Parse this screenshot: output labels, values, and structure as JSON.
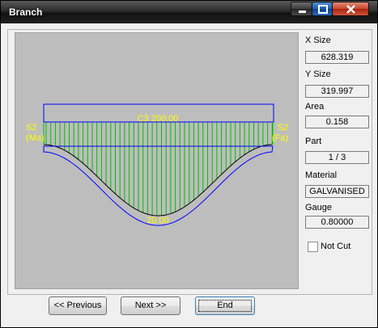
{
  "window": {
    "title": "Branch",
    "buttons": {
      "minimize": "minimize",
      "maximize": "maximize",
      "close": "close"
    }
  },
  "drawing": {
    "top_label": "C3 200.00",
    "bottom_label": "20.00",
    "left_label_1": "S2",
    "left_label_2": "(Ma)",
    "right_label_1": "S2",
    "right_label_2": "(Fa)",
    "colors": {
      "outline": "#0000ff",
      "hatch": "#00c000",
      "inner": "#000000",
      "label": "#ffff00",
      "background": "#bdbdbd"
    }
  },
  "info": {
    "x_size_label": "X Size",
    "x_size_value": "628.319",
    "y_size_label": "Y Size",
    "y_size_value": "319.997",
    "area_label": "Area",
    "area_value": "0.158",
    "part_label": "Part",
    "part_value": "1 / 3",
    "material_label": "Material",
    "material_value": "GALVANISED",
    "gauge_label": "Gauge",
    "gauge_value": "0.80000",
    "not_cut_label": "Not Cut",
    "not_cut_checked": false
  },
  "nav": {
    "previous_label": "<< Previous",
    "next_label": "Next >>",
    "end_label": "End"
  }
}
